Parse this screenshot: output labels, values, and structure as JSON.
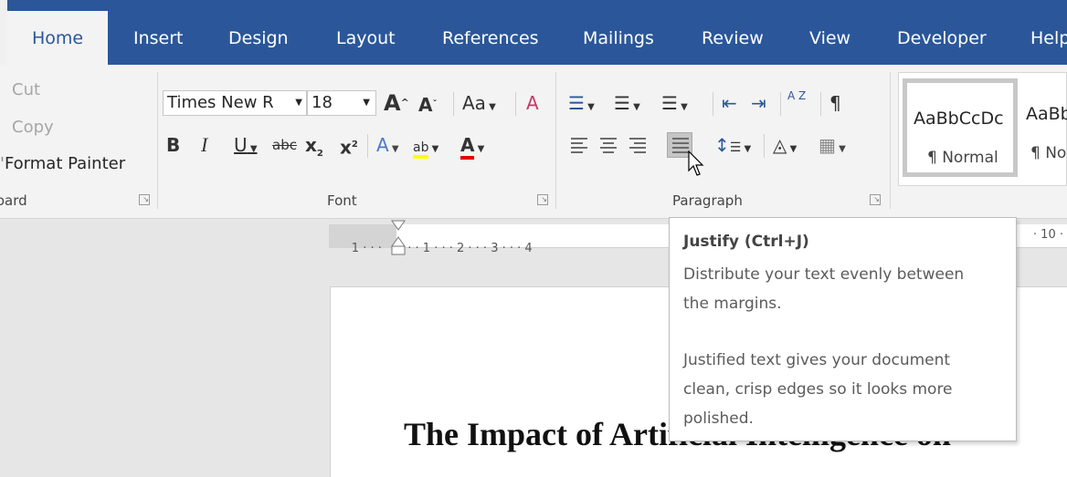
{
  "tabs": [
    "Home",
    "Insert",
    "Design",
    "Layout",
    "References",
    "Mailings",
    "Review",
    "View",
    "Developer",
    "Help"
  ],
  "clipboard": {
    "cut": "Cut",
    "copy": "Copy",
    "format_painter": "Format Painter",
    "group_label": "Clipboard"
  },
  "font": {
    "name": "Times New R",
    "size": "18",
    "group_label": "Font",
    "change_case": "Aa",
    "bold": "B",
    "italic": "I",
    "underline": "U",
    "strike": "abc",
    "grow": "A",
    "shrink": "A",
    "sub": "x",
    "sup": "x",
    "texteffect": "A",
    "highlight": "ab",
    "fontcolor": "A",
    "highlight_color": "#ffff00",
    "fontcolor_color": "#e00000"
  },
  "paragraph": {
    "group_label": "Paragraph",
    "show_marks": "¶",
    "sort": "A Z"
  },
  "styles": {
    "items": [
      {
        "sample": "AaBbCcDc",
        "name": "¶ Normal"
      },
      {
        "sample": "AaBbCcDc",
        "name": "¶ No Spac..."
      }
    ]
  },
  "ruler": {
    "left_text": "1 · · · ",
    "main_text": "· · · 1 · · · 2 · · · 3 · · · 4",
    "right_text": "· 10 ·"
  },
  "document": {
    "title": "The Impact of Artificial Intelligence on"
  },
  "tooltip": {
    "title": "Justify (Ctrl+J)",
    "lines1": [
      "Distribute your text evenly between",
      "the margins."
    ],
    "lines2": [
      "Justified text gives your document",
      "clean, crisp edges so it looks more",
      "polished."
    ]
  },
  "colors": {
    "brand": "#2b579a",
    "ribbon": "#f3f3f3"
  }
}
